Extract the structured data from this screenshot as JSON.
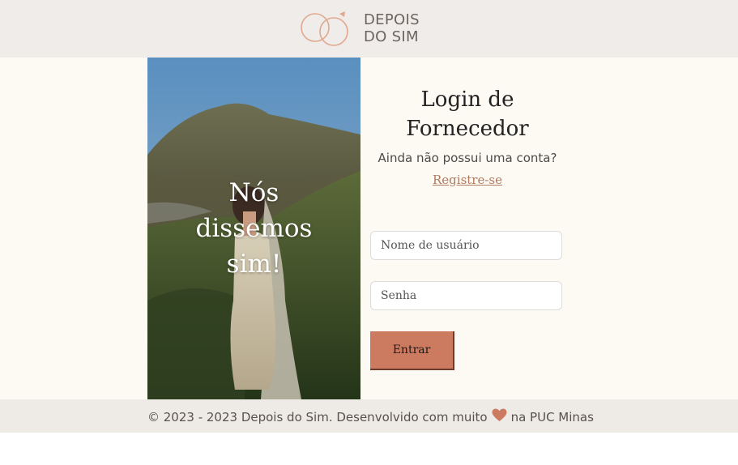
{
  "header": {
    "logo_line1": "DEPOIS",
    "logo_line2": "DO SIM"
  },
  "hero": {
    "caption_line1": "Nós",
    "caption_line2": "dissemos",
    "caption_line3": "sim!"
  },
  "login": {
    "title_line1": "Login de",
    "title_line2": "Fornecedor",
    "no_account": "Ainda não possui uma conta?",
    "register_link": "Registre-se",
    "username_placeholder": "Nome de usuário",
    "password_placeholder": "Senha",
    "submit_label": "Entrar"
  },
  "footer": {
    "text_before": "© 2023 - 2023 Depois do Sim. Desenvolvido com muito",
    "text_after": "na PUC Minas"
  },
  "colors": {
    "accent": "#cc7a60",
    "header_bg": "#f0ecea",
    "main_bg": "#fdfaf3",
    "link": "#b07b60"
  }
}
